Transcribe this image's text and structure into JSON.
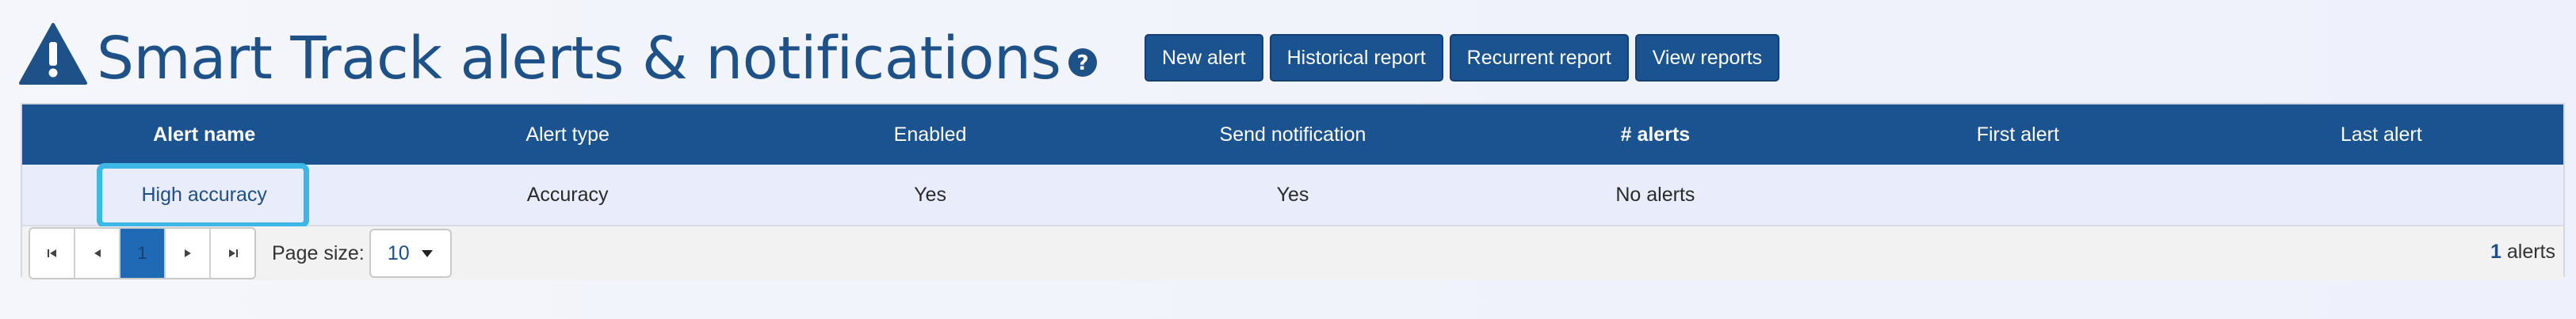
{
  "header": {
    "title": "Smart Track alerts & notifications"
  },
  "toolbar": {
    "new_alert": "New alert",
    "historical_report": "Historical report",
    "recurrent_report": "Recurrent report",
    "view_reports": "View reports"
  },
  "table": {
    "columns": [
      "Alert name",
      "Alert type",
      "Enabled",
      "Send notification",
      "# alerts",
      "First alert",
      "Last alert"
    ],
    "rows": [
      {
        "alert_name": "High accuracy",
        "alert_type": "Accuracy",
        "enabled": "Yes",
        "send_notification": "Yes",
        "alerts": "No alerts",
        "first_alert": "",
        "last_alert": ""
      }
    ]
  },
  "pager": {
    "current_page": "1",
    "page_size_label": "Page size:",
    "page_size": "10",
    "count": "1",
    "count_label": "alerts"
  },
  "colors": {
    "primary": "#1b5290",
    "highlight": "#3cb7e6",
    "row_bg": "#e8ecfb"
  }
}
